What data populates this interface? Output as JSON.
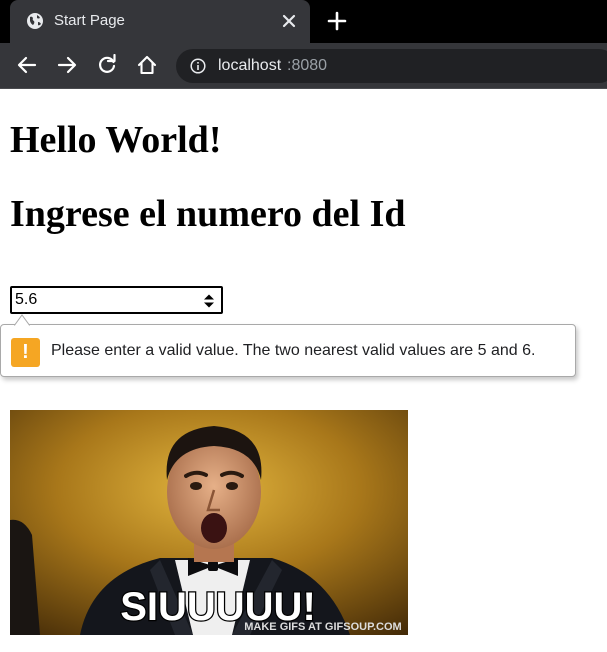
{
  "browser": {
    "tab_title": "Start Page",
    "url_host": "localhost",
    "url_port": ":8080"
  },
  "page": {
    "heading_hello": "Hello World!",
    "heading_ingrese": "Ingrese el numero del Id",
    "id_input": {
      "value": "5.6"
    },
    "validation_message": "Please enter a valid value. The two nearest valid values are 5 and 6.",
    "gif": {
      "caption": "SIUUUUU!",
      "watermark": "MAKE GIFS AT GIFSOUP.COM"
    }
  },
  "icons": {
    "tab_favicon": "globe-icon",
    "tab_close": "close-icon",
    "new_tab": "plus-icon",
    "back": "arrow-left-icon",
    "forward": "arrow-right-icon",
    "reload": "reload-icon",
    "home": "home-icon",
    "site_info": "info-icon",
    "validation": "warning-icon"
  },
  "colors": {
    "chrome_dark": "#35363a",
    "warning": "#f5a623"
  }
}
